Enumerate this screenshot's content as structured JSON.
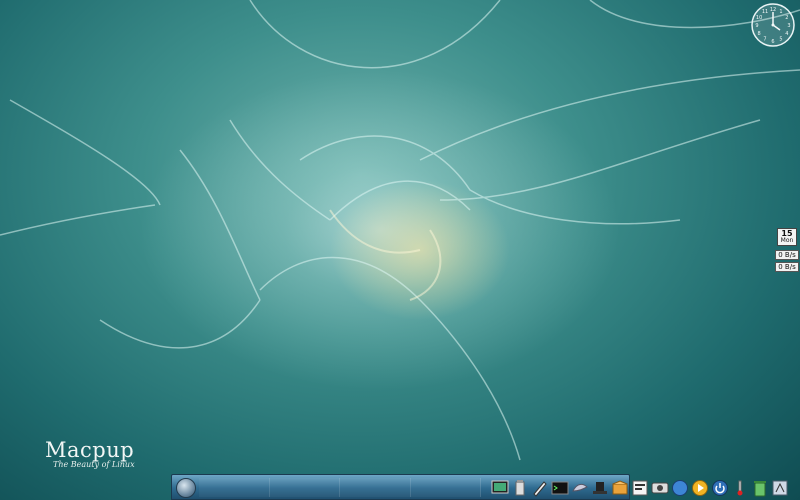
{
  "desktop": {
    "wallpaper": "fractal flame abstract",
    "colors": {
      "teal_dark": "#0f4c52",
      "teal_mid": "#3e8f8c",
      "glow": "#cfeff0"
    }
  },
  "clock": {
    "numerals": [
      "1",
      "2",
      "3",
      "4",
      "5",
      "6",
      "7",
      "8",
      "9",
      "10",
      "11",
      "12"
    ]
  },
  "calendar": {
    "day": "15",
    "weekday": "Mon"
  },
  "network": {
    "up": "0 B/s",
    "down": "0 B/s"
  },
  "logo": {
    "title": "Macpup",
    "tagline": "The Beauty of Linux"
  },
  "dock": {
    "start_icon": "puppy-start-icon",
    "icons": [
      "screen-icon",
      "usb-drive-icon",
      "pen-icon",
      "terminal-icon",
      "bird-icon",
      "hat-icon",
      "package-icon",
      "file-manager-icon",
      "image-viewer-icon",
      "browser-icon",
      "media-player-icon",
      "power-icon",
      "thermometer-icon",
      "trash-icon",
      "settings-icon"
    ]
  }
}
